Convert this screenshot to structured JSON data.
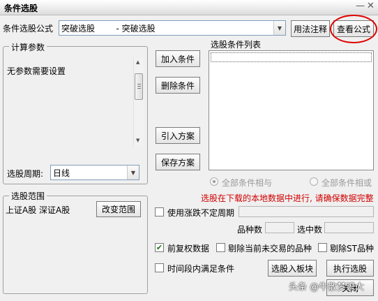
{
  "window": {
    "title": "条件选股",
    "min_glyph": "—",
    "close_glyph": "✕"
  },
  "formula": {
    "label": "条件选股公式",
    "selected": "突破选股        - 突破选股",
    "usage_button": "用法注释",
    "view_button": "查看公式"
  },
  "params": {
    "group_title": "计算参数",
    "message": "无参数需要设置",
    "period_label": "选股周期:",
    "period_value": "日线"
  },
  "actions": {
    "add_condition": "加入条件",
    "delete_condition": "删除条件",
    "import_plan": "引入方案",
    "save_plan": "保存方案"
  },
  "condition_list": {
    "label": "选股条件列表",
    "items": [],
    "logic_and": "全部条件相与",
    "logic_or": "全部条件相或",
    "and_selected": true
  },
  "notice": "选股在下载的本地数据中进行, 请确保数据完整",
  "scope": {
    "group_title": "选股范围",
    "value": "上证A股 深证A股",
    "change_button": "改变范围"
  },
  "options": {
    "variable_period": {
      "label": "使用涨跌不定周期",
      "checked": false
    },
    "count_label": "品种数",
    "selected_label": "选中数",
    "pre_adjust": {
      "label": "前复权数据",
      "checked": true
    },
    "exclude_untraded": {
      "label": "剔除当前未交易的品种",
      "checked": false
    },
    "exclude_st": {
      "label": "剔除ST品种",
      "checked": false
    },
    "time_window": {
      "label": "时间段内满足条件",
      "checked": false
    }
  },
  "bottom_buttons": {
    "to_board": "选股入板块",
    "execute": "执行选股",
    "close": "关闭"
  },
  "watermark": "头条 @牛散梦识大",
  "colors": {
    "annotation_circle": "#e00000",
    "notice_text": "#d00000",
    "check_mark": "#1a6e1a"
  }
}
